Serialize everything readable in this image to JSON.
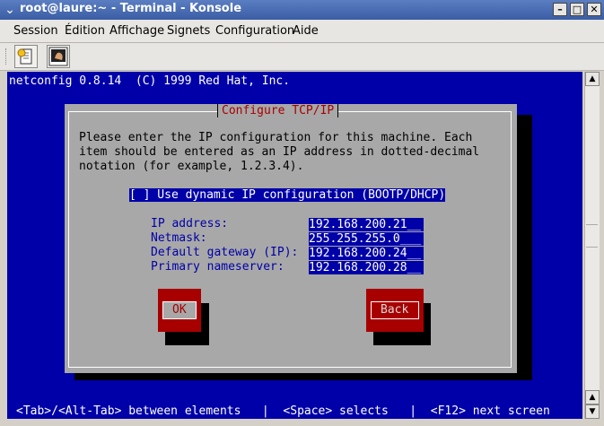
{
  "window": {
    "title": "root@laure:~ - Terminal - Konsole",
    "buttons": {
      "minimize": "–",
      "maximize": "□",
      "close": "✕"
    }
  },
  "menu": [
    "Session",
    "Édition",
    "Affichage",
    "Signets",
    "Configuration",
    "Aide"
  ],
  "toolbar": {
    "icons": [
      "new-session-icon",
      "konsole-app-icon"
    ]
  },
  "terminal": {
    "header": "netconfig 0.8.14  (C) 1999 Red Hat, Inc.",
    "footer": "<Tab>/<Alt-Tab> between elements   |  <Space> selects   |  <F12> next screen",
    "dialog": {
      "title": "Configure TCP/IP",
      "description": "Please enter the IP configuration for this machine. Each\nitem should be entered as an IP address in dotted-decimal\nnotation (for example, 1.2.3.4).",
      "dhcp_checkbox": "[ ] Use dynamic IP configuration (BOOTP/DHCP)",
      "fields": [
        {
          "label": "IP address:",
          "value": "192.168.200.21__"
        },
        {
          "label": "Netmask:",
          "value": "255.255.255.0___"
        },
        {
          "label": "Default gateway (IP):",
          "value": "192.168.200.24__"
        },
        {
          "label": "Primary nameserver:",
          "value": "192.168.200.28__"
        }
      ],
      "ok_label": "OK",
      "back_label": "Back"
    }
  },
  "colors": {
    "terminal_bg": "#0000a8",
    "dialog_bg": "#a8a8a8",
    "accent_red": "#a80000"
  }
}
